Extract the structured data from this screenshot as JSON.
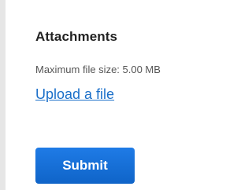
{
  "attachments": {
    "heading": "Attachments",
    "max_size_text": "Maximum file size: 5.00 MB",
    "upload_link_label": "Upload a file"
  },
  "form": {
    "submit_label": "Submit"
  },
  "colors": {
    "link": "#1a6fc9",
    "button": "#1670d8",
    "heading": "#222222",
    "hint": "#555555"
  }
}
